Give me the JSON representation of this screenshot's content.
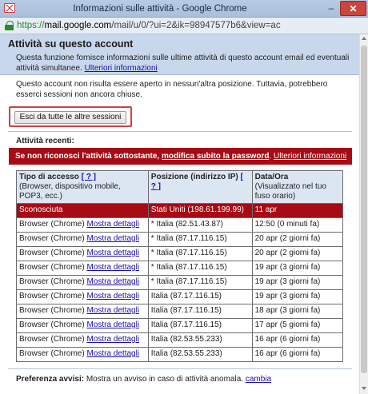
{
  "window": {
    "title": "Informazioni sulle attività - Google Chrome",
    "minimize": "–",
    "close": "✕"
  },
  "address": {
    "scheme": "https://",
    "host": "mail.google.com",
    "path": "/mail/u/0/?ui=2&ik=98947577b6&view=ac"
  },
  "header": {
    "title": "Attività su questo account",
    "description": "Questa funzione fornisce informazioni sulle ultime attività di questo account email ed eventuali attività simultanee.",
    "more_link": "Ulteriori informazioni"
  },
  "session_text": "Questo account non risulta essere aperto in nessun'altra posizione. Tuttavia, potrebbero esserci sessioni non ancora chiuse.",
  "signout_button": "Esci da tutte le altre sessioni",
  "recent": {
    "heading": "Attività recenti:",
    "warning_text": "Se non riconosci l'attività sottostante,",
    "warning_link": "modifica subito la password",
    "warning_more": "Ulteriori informazioni"
  },
  "table": {
    "col1_title": "Tipo di accesso",
    "col1_help": "[ ? ]",
    "col1_sub": "(Browser, dispositivo mobile, POP3, ecc.)",
    "col2_title": "Posizione (indirizzo IP)",
    "col2_help": "[ ? ]",
    "col3_title": "Data/Ora",
    "col3_sub": "(Visualizzato nel tuo fuso orario)",
    "rows": [
      {
        "type": "Sconosciuta",
        "link": "",
        "location": "Stati Uniti (198.61.199.99)",
        "date": "11 apr"
      },
      {
        "type": "Browser (Chrome)",
        "link": "Mostra dettagli",
        "location": "* Italia (82.51.43.87)",
        "date": "12:50 (0 minuti fa)"
      },
      {
        "type": "Browser (Chrome)",
        "link": "Mostra dettagli",
        "location": "* Italia (87.17.116.15)",
        "date": "20 apr (2 giorni fa)"
      },
      {
        "type": "Browser (Chrome)",
        "link": "Mostra dettagli",
        "location": "* Italia (87.17.116.15)",
        "date": "20 apr (2 giorni fa)"
      },
      {
        "type": "Browser (Chrome)",
        "link": "Mostra dettagli",
        "location": "* Italia (87.17.116.15)",
        "date": "19 apr (3 giorni fa)"
      },
      {
        "type": "Browser (Chrome)",
        "link": "Mostra dettagli",
        "location": "* Italia (87.17.116.15)",
        "date": "19 apr (3 giorni fa)"
      },
      {
        "type": "Browser (Chrome)",
        "link": "Mostra dettagli",
        "location": "Italia (87.17.116.15)",
        "date": "19 apr (3 giorni fa)"
      },
      {
        "type": "Browser (Chrome)",
        "link": "Mostra dettagli",
        "location": "Italia (87.17.116.15)",
        "date": "18 apr (3 giorni fa)"
      },
      {
        "type": "Browser (Chrome)",
        "link": "Mostra dettagli",
        "location": "Italia (87.17.116.15)",
        "date": "17 apr (5 giorni fa)"
      },
      {
        "type": "Browser (Chrome)",
        "link": "Mostra dettagli",
        "location": "Italia (82.53.55.233)",
        "date": "16 apr (6 giorni fa)"
      },
      {
        "type": "Browser (Chrome)",
        "link": "Mostra dettagli",
        "location": "Italia (82.53.55.233)",
        "date": "16 apr (6 giorni fa)"
      }
    ]
  },
  "preference": {
    "label": "Preferenza avvisi:",
    "text": "Mostra un avviso in caso di attività anomala.",
    "link": "cambia"
  },
  "colors": {
    "alert_red": "#a60b16",
    "header_blue": "#c8d7eb",
    "link_blue": "#1a0dab"
  }
}
